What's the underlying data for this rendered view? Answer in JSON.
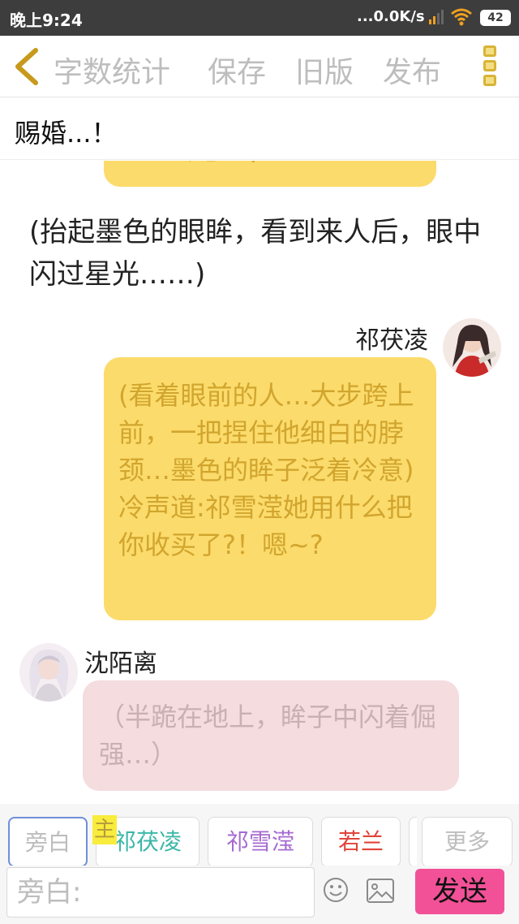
{
  "status_bar": {
    "time": "晚上9:24",
    "network_speed": "...0.0K/s",
    "battery": "42"
  },
  "toolbar": {
    "word_count": "字数统计",
    "save": "保存",
    "old_version": "旧版",
    "publish": "发布"
  },
  "title": "赐婚...！",
  "messages": {
    "top_bubble_partial": "……冷意…)",
    "narration": "(抬起墨色的眼眸，看到来人后，眼中闪过星光……)",
    "msg1": {
      "speaker": "祁茯凌",
      "text": "(看着眼前的人…大步跨上前，一把捏住他细白的脖颈…墨色的眸子泛着冷意)冷声道:祁雪滢她用什么把你收买了?！嗯~?"
    },
    "msg2": {
      "speaker": "沈陌离",
      "text": "（半跪在地上，眸子中闪着倔强…）"
    }
  },
  "roles": {
    "narrator": "旁白",
    "main_tag": "主",
    "role1": "祁茯凌",
    "role2": "祁雪滢",
    "role3": "若兰",
    "more": "更多"
  },
  "input": {
    "placeholder": "旁白:",
    "send": "发送"
  },
  "colors": {
    "accent_yellow": "#fbdb6b",
    "bubble_pink": "#f4dcdf",
    "send_button": "#f25197",
    "role1_color": "#3cb7a8",
    "role2_color": "#a66ad1",
    "role3_color": "#e0443a"
  }
}
